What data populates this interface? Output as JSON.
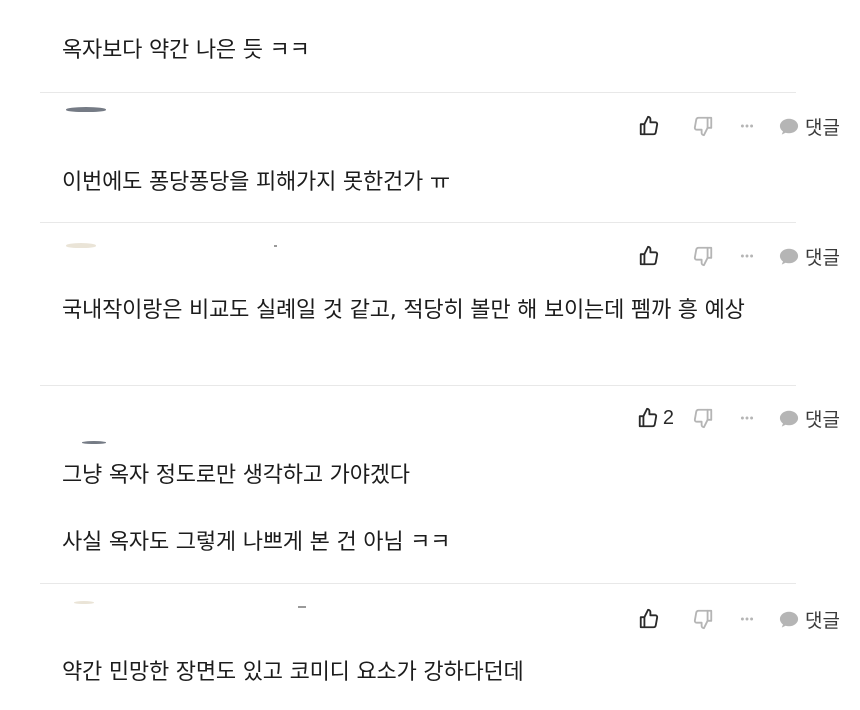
{
  "icons": {
    "like": "thumbs-up-icon",
    "dislike": "thumbs-down-icon",
    "more": "more-dots-icon",
    "reply": "speech-bubble-icon"
  },
  "colors": {
    "text": "#1c1c1c",
    "icon": "#2a2a2a",
    "icon_muted": "#b5b5b5",
    "divider": "#e8e8e8"
  },
  "comments": [
    {
      "text": "옥자보다 약간 나은 듯 ㅋㅋ"
    },
    {
      "text": "이번에도 퐁당퐁당을 피해가지 못한건가 ㅠ",
      "like_count": "",
      "reply_label": "댓글"
    },
    {
      "text": "국내작이랑은 비교도 실례일 것 같고, 적당히 볼만 해 보이는데 펨까 흥 예상",
      "like_count": "",
      "reply_label": "댓글"
    },
    {
      "text_lines": [
        "그냥 옥자 정도로만 생각하고 가야겠다",
        "사실 옥자도 그렇게 나쁘게 본 건 아님 ㅋㅋ"
      ],
      "like_count": "2",
      "reply_label": "댓글"
    },
    {
      "text": "약간 민망한 장면도 있고 코미디 요소가 강하다던데",
      "like_count": "",
      "reply_label": "댓글"
    }
  ]
}
